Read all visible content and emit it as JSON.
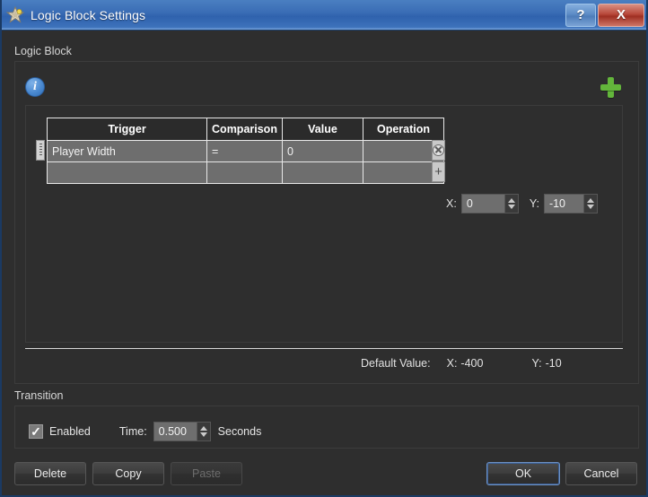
{
  "window": {
    "title": "Logic Block Settings",
    "icon": "star-icon",
    "help_label": "?",
    "close_label": "X"
  },
  "logic_block": {
    "group_label": "Logic Block",
    "info_icon": "info-icon",
    "info_glyph": "i",
    "add_block_icon": "plus-icon",
    "remove_block_icon": "x-icon",
    "table": {
      "columns": [
        "Trigger",
        "Comparison",
        "Value",
        "Operation"
      ],
      "rows": [
        {
          "trigger": "Player Width",
          "comparison": "=",
          "value": "0",
          "operation": ""
        },
        {
          "trigger": "",
          "comparison": "",
          "value": "",
          "operation": ""
        }
      ],
      "row_remove_icon": "circle-x-icon",
      "row_add_icon": "plus-icon",
      "drag_handle_icon": "grip-dots-icon"
    },
    "coords": {
      "x_label": "X:",
      "x_value": "0",
      "y_label": "Y:",
      "y_value": "-10"
    },
    "default_value": {
      "label": "Default Value:",
      "x_label": "X:",
      "x_value": "-400",
      "y_label": "Y:",
      "y_value": "-10"
    }
  },
  "transition": {
    "group_label": "Transition",
    "enabled_label": "Enabled",
    "enabled_checked": true,
    "check_glyph": "✓",
    "time_label": "Time:",
    "time_value": "0.500",
    "seconds_label": "Seconds"
  },
  "buttons": {
    "delete": "Delete",
    "copy": "Copy",
    "paste": "Paste",
    "ok": "OK",
    "cancel": "Cancel"
  },
  "colors": {
    "titlebar_blue": "#3a6db5",
    "close_red": "#b8483a",
    "add_green": "#63b63b",
    "remove_orange": "#e3661f",
    "info_blue": "#4a89d0",
    "window_bg": "#2e2e2e",
    "cell_bg": "#6e6e6e"
  }
}
